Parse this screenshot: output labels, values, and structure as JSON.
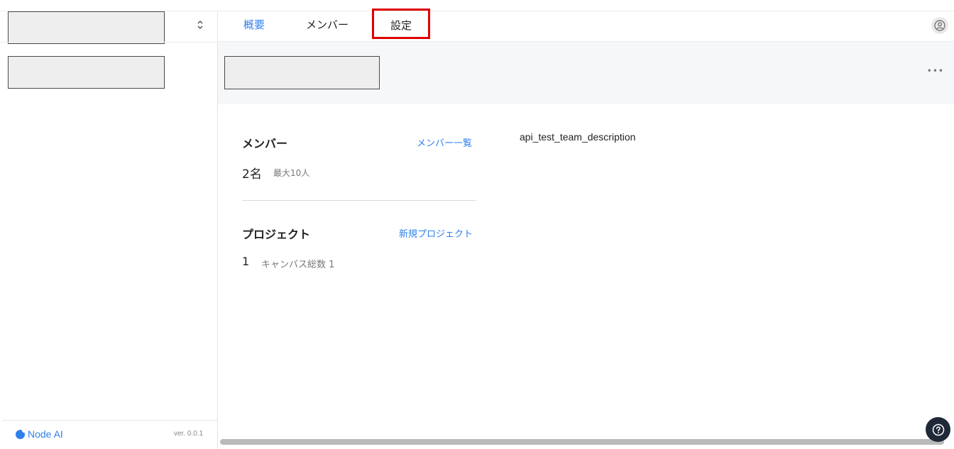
{
  "header": {
    "tabs": [
      {
        "label": "概要"
      },
      {
        "label": "メンバー"
      },
      {
        "label": "設定"
      }
    ]
  },
  "sidebar": {
    "select_icon": "chevron-up-down-icon",
    "footer": {
      "logo_text": "Node AI",
      "version": "ver. 0.0.1"
    }
  },
  "main": {
    "description": "api_test_team_description",
    "members": {
      "heading": "メンバー",
      "link": "メンバー一覧",
      "count": "2名",
      "max": "最大10人"
    },
    "projects": {
      "heading": "プロジェクト",
      "link": "新規プロジェクト",
      "count": "1",
      "canvas_total": "キャンバス総数 1"
    },
    "more_icon": "ellipsis-icon"
  },
  "colors": {
    "accent": "#2f80ed",
    "highlight": "#e00000",
    "help_button": "#1f2937"
  }
}
